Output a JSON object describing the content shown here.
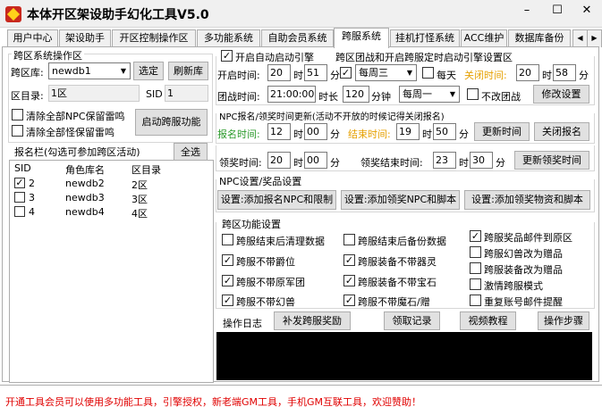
{
  "window": {
    "title": "本体开区架设助手幻化工具V5.0",
    "min": "–",
    "max": "☐",
    "close": "✕"
  },
  "tabs": [
    "用户中心",
    "架设助手",
    "开区控制操作区",
    "多功能系统",
    "自助会员系统",
    "跨服系统",
    "挂机打怪系统",
    "ACC维护",
    "数据库备份"
  ],
  "active_tab": "跨服系统",
  "left": {
    "group_title": "跨区系统操作区",
    "db_label": "跨区库:",
    "db_value": "newdb1",
    "select_btn": "选定",
    "refresh_btn": "刷新库",
    "dir_label": "区目录:",
    "dir_value": "1区",
    "sid_label": "SID",
    "sid_value": "1",
    "clear_npc": "清除全部NPC保留雷鸣",
    "clear_monster": "清除全部怪保留雷鸣",
    "start_btn": "启动跨服功能",
    "reg_title": "报名栏(勾选可参加跨区活动)",
    "select_all": "全选",
    "columns": [
      "SID",
      "角色库名",
      "区目录"
    ],
    "rows": [
      {
        "checked": true,
        "sid": "2",
        "db": "newdb2",
        "dir": "2区"
      },
      {
        "checked": false,
        "sid": "3",
        "db": "newdb3",
        "dir": "3区"
      },
      {
        "checked": false,
        "sid": "4",
        "db": "newdb4",
        "dir": "4区"
      }
    ]
  },
  "right": {
    "auto_start": "开启自动启动引擎",
    "auto_start_checked": true,
    "war_title": "跨区团战和开启跨服定时启动引擎设置区",
    "open_time_label": "开启时间:",
    "open_h": "20",
    "open_m": "51",
    "h": "时",
    "m": "分",
    "week_checked": true,
    "week_value": "每周三",
    "daily_label": "每天",
    "close_time_label": "关闭时间:",
    "close_h": "20",
    "close_m": "58",
    "war_time_label": "团战时间:",
    "war_time": "21:00:00",
    "duration_label": "时长",
    "duration": "120",
    "minute_clock": "分钟",
    "war_week": "每周一",
    "no_change": "不改团战",
    "modify_btn": "修改设置",
    "npc_title": "NPC报名/领奖时间更新(活动不开放的时候记得关闭报名)",
    "reg_time_label": "报名时间:",
    "reg_h": "12",
    "reg_m": "00",
    "end_time_label": "结束时间:",
    "end_h": "19",
    "end_m": "50",
    "update_time_btn": "更新时间",
    "close_reg_btn": "关闭报名",
    "award_time_label": "领奖时间:",
    "award_h": "20",
    "award_m": "00",
    "award_end_label": "领奖结束时间:",
    "award_end_h": "23",
    "award_end_m": "30",
    "update_award_btn": "更新领奖时间",
    "npc_setting_title": "NPC设置/奖品设置",
    "npc_btn1": "设置:添加报名NPC和限制",
    "npc_btn2": "设置:添加领奖NPC和脚本",
    "npc_btn3": "设置:添加领奖物资和脚本",
    "func_title": "跨区功能设置",
    "options": [
      {
        "label": "跨服结束后清理数据",
        "checked": false
      },
      {
        "label": "跨服结束后备份数据",
        "checked": false
      },
      {
        "label": "跨服奖品邮件到原区",
        "checked": true
      },
      {
        "label": "跨服不带爵位",
        "checked": true
      },
      {
        "label": "跨服装备不带器灵",
        "checked": true
      },
      {
        "label": "跨服幻兽改为赠品",
        "checked": false
      },
      {
        "label": "跨服不带原军团",
        "checked": true
      },
      {
        "label": "跨服装备不带宝石",
        "checked": true
      },
      {
        "label": "跨服装备改为赠品",
        "checked": false
      },
      {
        "label": "激情跨服模式",
        "checked": false
      },
      {
        "label": "跨服不带幻兽",
        "checked": true
      },
      {
        "label": "跨服不带魔石/赠",
        "checked": true
      },
      {
        "label": "重复账号邮件提醒",
        "checked": false
      }
    ],
    "log_label": "操作日志",
    "reissue_btn": "补发跨服奖励",
    "claim_btn": "领取记录",
    "video_btn": "视频教程",
    "steps_btn": "操作步骤"
  },
  "status": "开通工具会员可以使用多功能工具，引擎授权，新老端GM工具，手机GM互联工具，欢迎赞助！"
}
